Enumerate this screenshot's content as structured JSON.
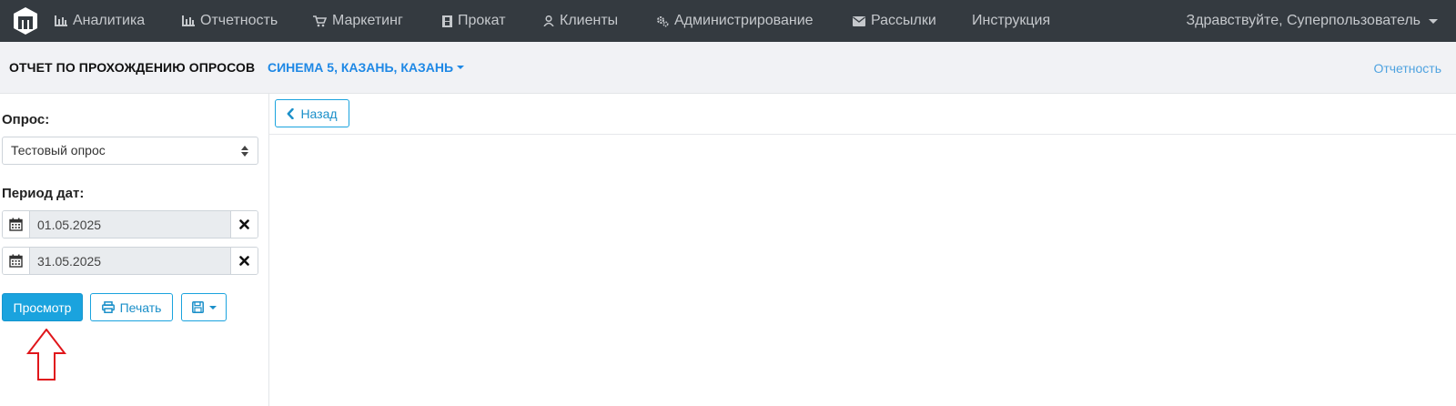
{
  "nav": {
    "items": [
      {
        "label": "Аналитика",
        "icon": "bar-chart-icon"
      },
      {
        "label": "Отчетность",
        "icon": "bar-chart-icon"
      },
      {
        "label": "Маркетинг",
        "icon": "cart-icon"
      },
      {
        "label": "Прокат",
        "icon": "film-icon"
      },
      {
        "label": "Клиенты",
        "icon": "user-icon"
      },
      {
        "label": "Администрирование",
        "icon": "gears-icon"
      },
      {
        "label": "Рассылки",
        "icon": "envelope-icon"
      },
      {
        "label": "Инструкция",
        "icon": ""
      }
    ],
    "user_greeting": "Здравствуйте, Суперпользователь"
  },
  "subheader": {
    "title": "ОТЧЕТ ПО ПРОХОЖДЕНИЮ ОПРОСОВ",
    "cinema": "СИНЕМА 5, КАЗАНЬ, КАЗАНЬ",
    "breadcrumb": "Отчетность"
  },
  "sidebar": {
    "survey_label": "Опрос:",
    "survey_value": "Тестовый опрос",
    "period_label": "Период дат:",
    "date_from": "01.05.2025",
    "date_to": "31.05.2025",
    "view_button": "Просмотр",
    "print_button": "Печать"
  },
  "main": {
    "back_button": "Назад"
  },
  "colors": {
    "navbar": "#343a40",
    "accent": "#1aa3de",
    "link": "#1e88e5",
    "annotation_arrow": "#e0161b"
  }
}
